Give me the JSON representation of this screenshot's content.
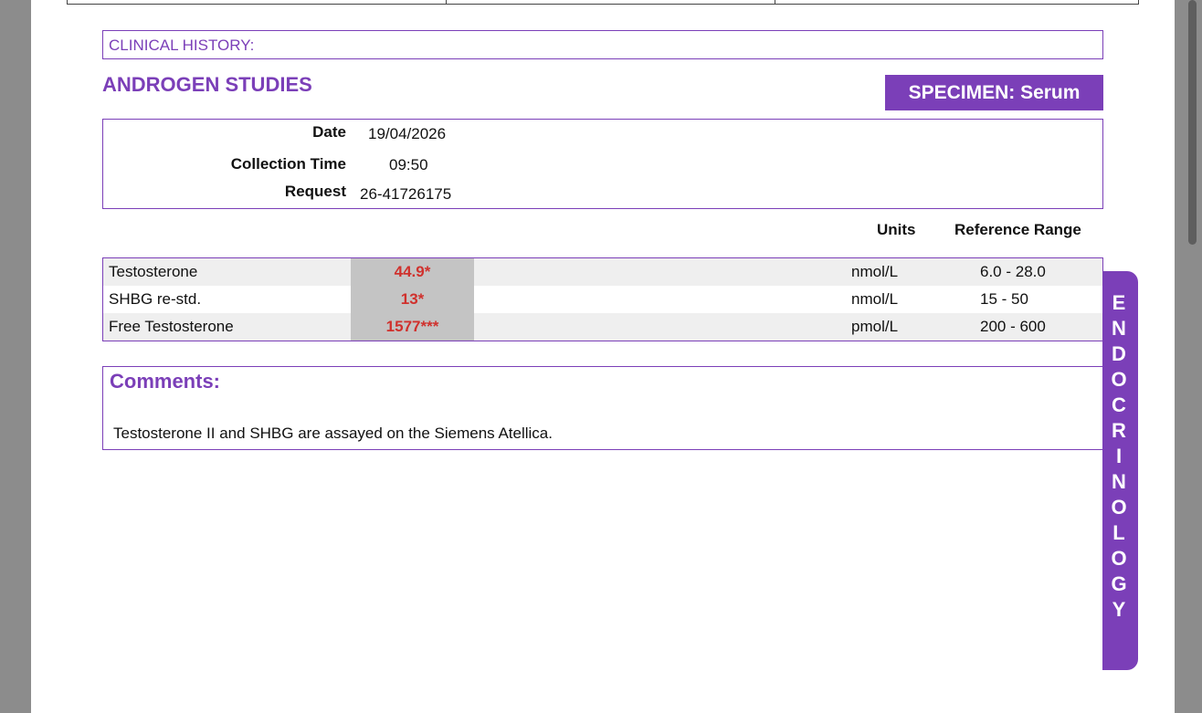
{
  "clinical_history_label": "CLINICAL HISTORY:",
  "section_title": "ANDROGEN STUDIES",
  "specimen": "SPECIMEN: Serum",
  "info": {
    "date_label": "Date",
    "date_value": "19/04/2026",
    "collection_time_label": "Collection Time",
    "collection_time_value": "09:50",
    "request_label": "Request",
    "request_value": "26-41726175"
  },
  "columns": {
    "units": "Units",
    "reference_range": "Reference Range"
  },
  "results": [
    {
      "test": "Testosterone",
      "result": "44.9*",
      "units": "nmol/L",
      "range": "6.0 - 28.0"
    },
    {
      "test": "SHBG re-std.",
      "result": "13*",
      "units": "nmol/L",
      "range": "15 - 50"
    },
    {
      "test": "Free Testosterone",
      "result": "1577***",
      "units": "pmol/L",
      "range": "200 - 600"
    }
  ],
  "comments": {
    "title": "Comments:",
    "text": "Testosterone II and SHBG are assayed on the Siemens Atellica."
  },
  "side_tab": [
    "E",
    "N",
    "D",
    "O",
    "C",
    "R",
    "I",
    "N",
    "O",
    "L",
    "O",
    "G",
    "Y"
  ],
  "colors": {
    "accent": "#7b3fb8",
    "flag": "#d0312d",
    "result_cell": "#c4c4c4",
    "row_shade": "#efefef"
  }
}
